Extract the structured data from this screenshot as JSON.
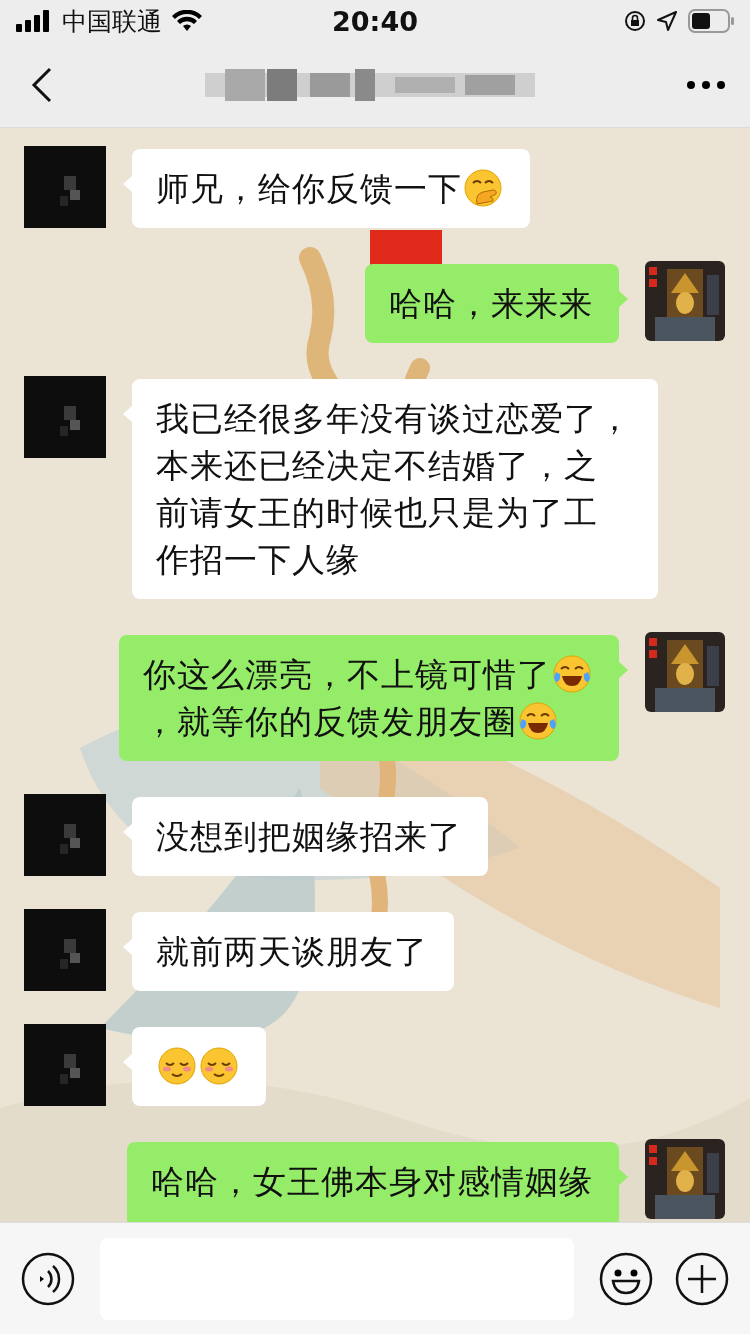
{
  "status_bar": {
    "carrier": "中国联通",
    "time": "20:40"
  },
  "messages": [
    {
      "kind": "received",
      "parts": [
        {
          "kind": "text",
          "text": "师兄，给你反馈一下"
        },
        {
          "kind": "giggle"
        }
      ]
    },
    {
      "kind": "sent",
      "parts": [
        {
          "kind": "text",
          "text": "哈哈，来来来"
        }
      ]
    },
    {
      "kind": "received",
      "parts": [
        {
          "kind": "text",
          "text": "我已经很多年没有谈过恋爱了，"
        },
        {
          "kind": "break"
        },
        {
          "kind": "text",
          "text": "本来还已经决定不结婚了，之"
        },
        {
          "kind": "break"
        },
        {
          "kind": "text",
          "text": "前请女王的时候也只是为了工"
        },
        {
          "kind": "break"
        },
        {
          "kind": "text",
          "text": "作招一下人缘"
        }
      ]
    },
    {
      "kind": "sent",
      "parts": [
        {
          "kind": "text",
          "text": "你这么漂亮，不上镜可惜了"
        },
        {
          "kind": "tears-of-joy"
        },
        {
          "kind": "break"
        },
        {
          "kind": "text",
          "text": "，就等你的反馈发朋友圈"
        },
        {
          "kind": "tears-of-joy"
        }
      ]
    },
    {
      "kind": "received",
      "parts": [
        {
          "kind": "text",
          "text": "没想到把姻缘招来了"
        }
      ]
    },
    {
      "kind": "received",
      "parts": [
        {
          "kind": "text",
          "text": "就前两天谈朋友了"
        }
      ]
    },
    {
      "kind": "received",
      "parts": [
        {
          "kind": "content"
        },
        {
          "kind": "content"
        }
      ]
    },
    {
      "kind": "sent-cut",
      "parts": [
        {
          "kind": "text",
          "text": "哈哈，女王佛本身对感情姻缘"
        }
      ]
    }
  ]
}
